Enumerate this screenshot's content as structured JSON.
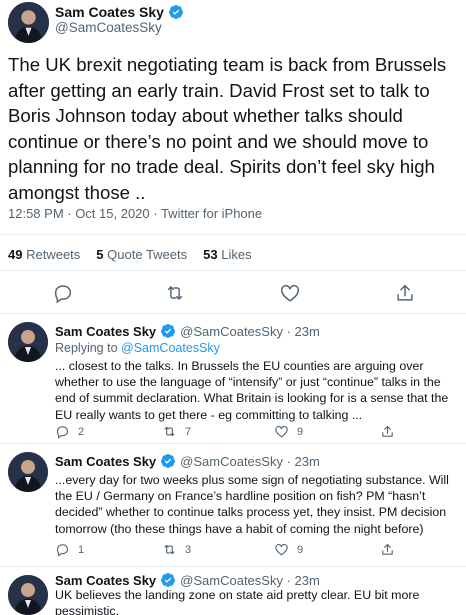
{
  "main_tweet": {
    "author_name": "Sam Coates Sky",
    "author_handle": "@SamCoatesSky",
    "text": "The UK brexit negotiating team is back from Brussels after getting an early train. David Frost set to talk to Boris Johnson today about whether talks should continue or there’s no point and we should move to planning for no trade deal. Spirits don’t feel sky high amongst those ..",
    "meta": "12:58 PM · Oct 15, 2020 · Twitter for iPhone",
    "stats": {
      "retweets_count": "49",
      "retweets_label": "Retweets",
      "quotes_count": "5",
      "quotes_label": "Quote Tweets",
      "likes_count": "53",
      "likes_label": "Likes"
    }
  },
  "replies": [
    {
      "author_name": "Sam Coates Sky",
      "author_handle": "@SamCoatesSky · 23m",
      "replying_prefix": "Replying to",
      "replying_to": "@SamCoatesSky",
      "text": "... closest to the talks. In Brussels the EU counties are arguing over whether to use the language of “intensify” or just “continue” talks in the end of summit declaration. What Britain is looking for is a sense that the EU really wants to get there - eg committing to talking ...",
      "reply_count": "2",
      "retweet_count": "7",
      "like_count": "9"
    },
    {
      "author_name": "Sam Coates Sky",
      "author_handle": "@SamCoatesSky · 23m",
      "text": "...every day for two weeks plus some sign of negotiating substance. Will the EU / Germany on France’s hardline position on fish? PM “hasn’t decided” whether to continue talks process yet, they insist. PM decision tomorrow (tho these things have a habit of coming the night before)",
      "reply_count": "1",
      "retweet_count": "3",
      "like_count": "9"
    },
    {
      "author_name": "Sam Coates Sky",
      "author_handle": "@SamCoatesSky · 23m",
      "text": "UK believes the landing zone on state aid pretty clear. EU bit more pessimistic."
    }
  ],
  "icons": {
    "verified": "verified-badge-icon",
    "reply": "reply-icon",
    "retweet": "retweet-icon",
    "like": "heart-icon",
    "share": "share-icon"
  },
  "colors": {
    "verified_blue": "#1d9bf0",
    "secondary_text": "#536471",
    "divider": "#e6ecf0"
  }
}
